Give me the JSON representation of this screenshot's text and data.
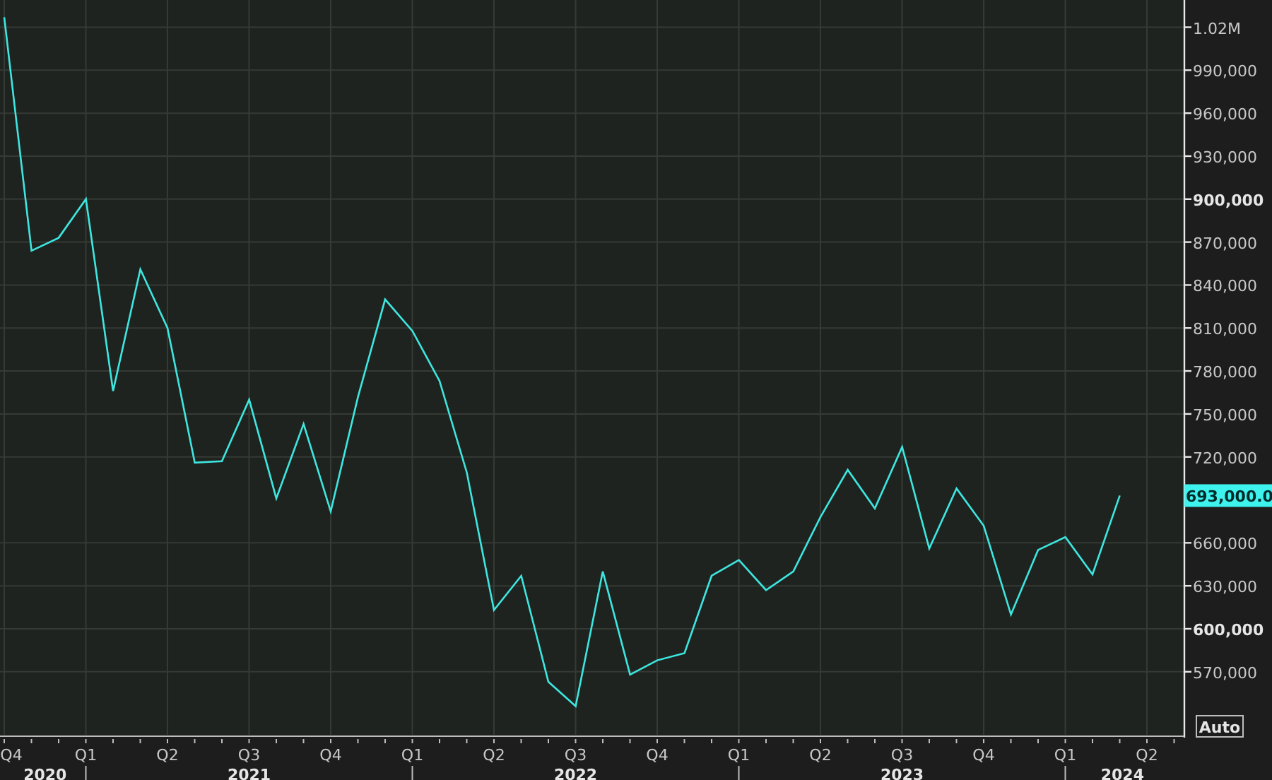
{
  "chart_data": {
    "type": "line",
    "grid": true,
    "ylim": [
      526000,
      1039000
    ],
    "series": [
      {
        "color": "#3ee6e0",
        "values": [
          1027000,
          864000,
          873000,
          900000,
          766000,
          851000,
          810000,
          716000,
          717000,
          760000,
          691000,
          743000,
          682000,
          762000,
          830000,
          808000,
          773000,
          709000,
          613000,
          637000,
          563000,
          546000,
          640000,
          568000,
          578000,
          583000,
          637000,
          648000,
          627000,
          640000,
          678000,
          711000,
          684000,
          727000,
          656000,
          698000,
          672000,
          610000,
          655000,
          664000,
          638000,
          693000
        ]
      }
    ],
    "yticks": [
      {
        "value": 1020000,
        "label": "1.02M"
      },
      {
        "value": 990000,
        "label": "990,000"
      },
      {
        "value": 960000,
        "label": "960,000"
      },
      {
        "value": 930000,
        "label": "930,000"
      },
      {
        "value": 900000,
        "label": "900,000"
      },
      {
        "value": 870000,
        "label": "870,000"
      },
      {
        "value": 840000,
        "label": "840,000"
      },
      {
        "value": 810000,
        "label": "810,000"
      },
      {
        "value": 780000,
        "label": "780,000"
      },
      {
        "value": 750000,
        "label": "750,000"
      },
      {
        "value": 720000,
        "label": "720,000"
      },
      {
        "value": 660000,
        "label": "660,000"
      },
      {
        "value": 630000,
        "label": "630,000"
      },
      {
        "value": 600000,
        "label": "600,000"
      },
      {
        "value": 570000,
        "label": "570,000"
      }
    ]
  },
  "quarter_labels": [
    "Q4",
    "Q1",
    "Q2",
    "Q3",
    "Q4",
    "Q1",
    "Q2",
    "Q3",
    "Q4",
    "Q1",
    "Q2",
    "Q3",
    "Q4",
    "Q1",
    "Q2"
  ],
  "years": [
    "2020",
    "2021",
    "2022",
    "2023",
    "2024"
  ],
  "last_value": {
    "label": "693,000.0"
  },
  "auto_button": {
    "label": "Auto"
  }
}
